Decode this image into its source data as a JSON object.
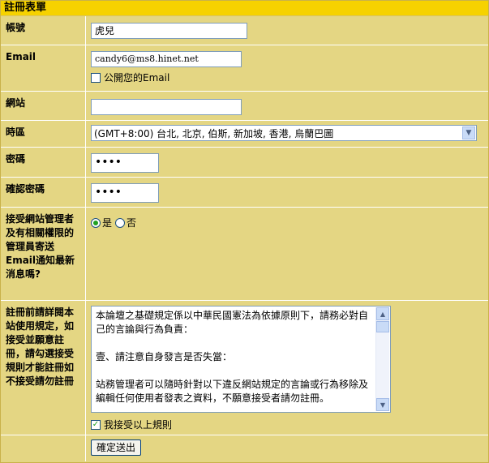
{
  "form": {
    "title": "註冊表單",
    "account": {
      "label": "帳號",
      "value": "虎兒"
    },
    "email": {
      "label": "Email",
      "value": "candy6@ms8.hinet.net",
      "public_label": "公開您的Email",
      "public_checked": false
    },
    "website": {
      "label": "網站",
      "value": ""
    },
    "timezone": {
      "label": "時區",
      "selected": "(GMT+8:00) 台北, 北京, 伯斯, 新加坡, 香港, 烏蘭巴圖"
    },
    "password": {
      "label": "密碼",
      "value": "••••"
    },
    "confirm_password": {
      "label": "確認密碼",
      "value": "••••"
    },
    "admin_mail": {
      "label": "接受網站管理者及有相關權限的管理員寄送Email通知最新消息嗎?",
      "yes_label": "是",
      "no_label": "否",
      "selected": "yes"
    },
    "rules": {
      "label": "註冊前請詳閱本站使用規定，如接受並願意註冊，請勾選接受規則才能註冊如不接受請勿註冊",
      "text": "本論壇之基礎規定係以中華民國憲法為依據原則下，請務必對自己的言論與行為負責：\n\n壹、請注意自身發言是否失當：\n\n站務管理者可以隨時針對以下違反網站規定的言論或行為移除及編輯任何使用者發表之資料，不願意接受者請勿註冊。",
      "accept_label": "我接受以上規則",
      "accept_checked": true
    },
    "submit_label": "確定送出"
  },
  "icons": {
    "checkbox_check": "✓",
    "dropdown": "chevron-down-icon",
    "scroll_up": "▲",
    "scroll_down": "▼",
    "dropdown_glyph": "▼"
  },
  "colors": {
    "header": "#f6d200",
    "panel": "#e4d683",
    "input_border": "#7f9db9",
    "check": "#21a121"
  }
}
